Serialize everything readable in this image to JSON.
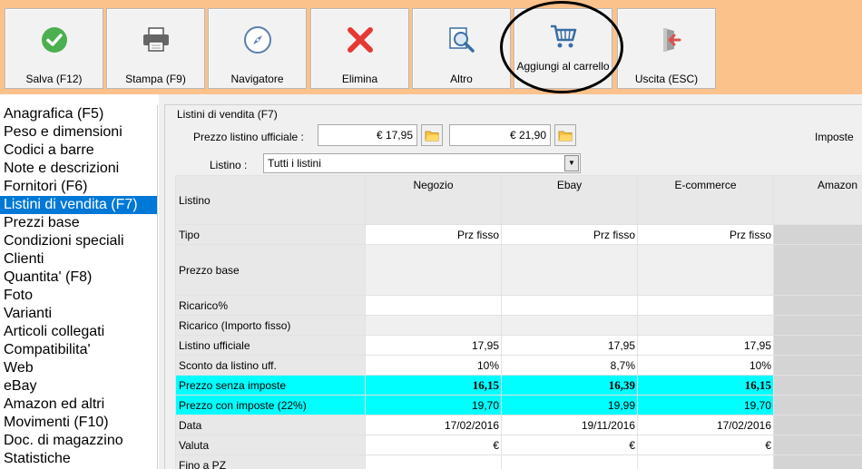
{
  "toolbar": {
    "buttons": [
      {
        "label": "Salva (F12)",
        "icon": "check-circle-icon",
        "color": "#4caf50"
      },
      {
        "label": "Stampa (F9)",
        "icon": "printer-icon",
        "color": "#555555"
      },
      {
        "label": "Navigatore",
        "icon": "compass-icon",
        "color": "#5a7fb0"
      },
      {
        "label": "Elimina",
        "icon": "x-icon",
        "color": "#e53935"
      },
      {
        "label": "Altro",
        "icon": "magnifier-icon",
        "color": "#3a6ea5"
      },
      {
        "label": "Aggiungi al carrello",
        "icon": "cart-icon",
        "color": "#3a6ea5"
      },
      {
        "label": "Uscita (ESC)",
        "icon": "exit-icon",
        "color": "#d9534f"
      }
    ]
  },
  "sidebar": {
    "items": [
      "Anagrafica (F5)",
      "Peso e dimensioni",
      "Codici a barre",
      "Note e descrizioni",
      "Fornitori (F6)",
      "Listini di vendita (F7)",
      "Prezzi base",
      "Condizioni speciali",
      "Clienti",
      "Quantita' (F8)",
      "Foto",
      "Varianti",
      "Articoli collegati",
      "Compatibilita'",
      "Web",
      "eBay",
      "Amazon ed altri",
      "Movimenti (F10)",
      "Doc. di magazzino",
      "Statistiche"
    ],
    "active_index": 5
  },
  "panel": {
    "title": "Listini di vendita (F7)",
    "prezzo_label": "Prezzo listino ufficiale :",
    "prezzo_value1": "€ 17,95",
    "prezzo_value2": "€ 21,90",
    "imposte_label": "Imposte",
    "listino_label": "Listino :",
    "listino_value": "Tutti i listini"
  },
  "grid": {
    "header_label": "Listino",
    "columns": [
      "Negozio",
      "Ebay",
      "E-commerce",
      "Amazon"
    ],
    "rows": {
      "tipo": {
        "label": "Tipo",
        "values": [
          "Prz fisso",
          "Prz fisso",
          "Prz fisso"
        ]
      },
      "prezzo_base": {
        "label": "Prezzo base"
      },
      "ricarico_pct": {
        "label": "Ricarico%"
      },
      "ricarico_fisso": {
        "label": "Ricarico (Importo fisso)"
      },
      "listino_ufficiale": {
        "label": "Listino ufficiale",
        "values": [
          "17,95",
          "17,95",
          "17,95"
        ]
      },
      "sconto": {
        "label": "Sconto da listino uff.",
        "values": [
          "10%",
          "8,7%",
          "10%"
        ]
      },
      "senza_imposte": {
        "label": "Prezzo senza imposte",
        "values": [
          "16,15",
          "16,39",
          "16,15"
        ]
      },
      "con_imposte": {
        "label": "Prezzo con imposte (22%)",
        "values": [
          "19,70",
          "19,99",
          "19,70"
        ]
      },
      "data": {
        "label": "Data",
        "values": [
          "17/02/2016",
          "19/11/2016",
          "17/02/2016"
        ]
      },
      "valuta": {
        "label": "Valuta",
        "values": [
          "€",
          "€",
          "€"
        ]
      },
      "fino_a": {
        "label": "Fino a PZ"
      }
    }
  }
}
